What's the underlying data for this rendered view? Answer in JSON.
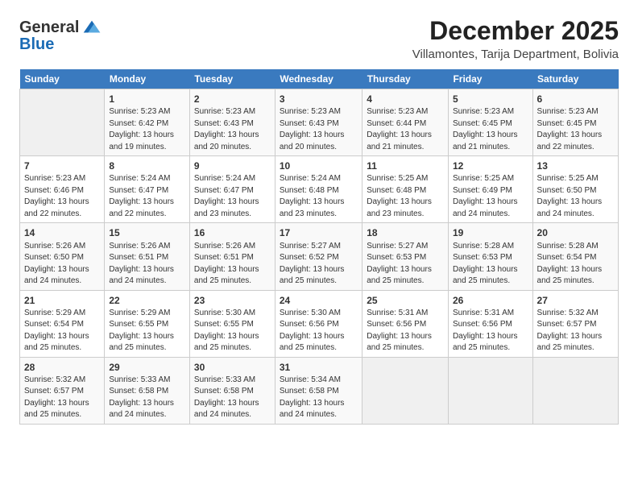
{
  "header": {
    "logo_line1": "General",
    "logo_line2": "Blue",
    "month": "December 2025",
    "location": "Villamontes, Tarija Department, Bolivia"
  },
  "days_of_week": [
    "Sunday",
    "Monday",
    "Tuesday",
    "Wednesday",
    "Thursday",
    "Friday",
    "Saturday"
  ],
  "weeks": [
    [
      {
        "day": "",
        "empty": true
      },
      {
        "day": "1",
        "sunrise": "Sunrise: 5:23 AM",
        "sunset": "Sunset: 6:42 PM",
        "daylight": "Daylight: 13 hours and 19 minutes."
      },
      {
        "day": "2",
        "sunrise": "Sunrise: 5:23 AM",
        "sunset": "Sunset: 6:43 PM",
        "daylight": "Daylight: 13 hours and 20 minutes."
      },
      {
        "day": "3",
        "sunrise": "Sunrise: 5:23 AM",
        "sunset": "Sunset: 6:43 PM",
        "daylight": "Daylight: 13 hours and 20 minutes."
      },
      {
        "day": "4",
        "sunrise": "Sunrise: 5:23 AM",
        "sunset": "Sunset: 6:44 PM",
        "daylight": "Daylight: 13 hours and 21 minutes."
      },
      {
        "day": "5",
        "sunrise": "Sunrise: 5:23 AM",
        "sunset": "Sunset: 6:45 PM",
        "daylight": "Daylight: 13 hours and 21 minutes."
      },
      {
        "day": "6",
        "sunrise": "Sunrise: 5:23 AM",
        "sunset": "Sunset: 6:45 PM",
        "daylight": "Daylight: 13 hours and 22 minutes."
      }
    ],
    [
      {
        "day": "7",
        "sunrise": "Sunrise: 5:23 AM",
        "sunset": "Sunset: 6:46 PM",
        "daylight": "Daylight: 13 hours and 22 minutes."
      },
      {
        "day": "8",
        "sunrise": "Sunrise: 5:24 AM",
        "sunset": "Sunset: 6:47 PM",
        "daylight": "Daylight: 13 hours and 22 minutes."
      },
      {
        "day": "9",
        "sunrise": "Sunrise: 5:24 AM",
        "sunset": "Sunset: 6:47 PM",
        "daylight": "Daylight: 13 hours and 23 minutes."
      },
      {
        "day": "10",
        "sunrise": "Sunrise: 5:24 AM",
        "sunset": "Sunset: 6:48 PM",
        "daylight": "Daylight: 13 hours and 23 minutes."
      },
      {
        "day": "11",
        "sunrise": "Sunrise: 5:25 AM",
        "sunset": "Sunset: 6:48 PM",
        "daylight": "Daylight: 13 hours and 23 minutes."
      },
      {
        "day": "12",
        "sunrise": "Sunrise: 5:25 AM",
        "sunset": "Sunset: 6:49 PM",
        "daylight": "Daylight: 13 hours and 24 minutes."
      },
      {
        "day": "13",
        "sunrise": "Sunrise: 5:25 AM",
        "sunset": "Sunset: 6:50 PM",
        "daylight": "Daylight: 13 hours and 24 minutes."
      }
    ],
    [
      {
        "day": "14",
        "sunrise": "Sunrise: 5:26 AM",
        "sunset": "Sunset: 6:50 PM",
        "daylight": "Daylight: 13 hours and 24 minutes."
      },
      {
        "day": "15",
        "sunrise": "Sunrise: 5:26 AM",
        "sunset": "Sunset: 6:51 PM",
        "daylight": "Daylight: 13 hours and 24 minutes."
      },
      {
        "day": "16",
        "sunrise": "Sunrise: 5:26 AM",
        "sunset": "Sunset: 6:51 PM",
        "daylight": "Daylight: 13 hours and 25 minutes."
      },
      {
        "day": "17",
        "sunrise": "Sunrise: 5:27 AM",
        "sunset": "Sunset: 6:52 PM",
        "daylight": "Daylight: 13 hours and 25 minutes."
      },
      {
        "day": "18",
        "sunrise": "Sunrise: 5:27 AM",
        "sunset": "Sunset: 6:53 PM",
        "daylight": "Daylight: 13 hours and 25 minutes."
      },
      {
        "day": "19",
        "sunrise": "Sunrise: 5:28 AM",
        "sunset": "Sunset: 6:53 PM",
        "daylight": "Daylight: 13 hours and 25 minutes."
      },
      {
        "day": "20",
        "sunrise": "Sunrise: 5:28 AM",
        "sunset": "Sunset: 6:54 PM",
        "daylight": "Daylight: 13 hours and 25 minutes."
      }
    ],
    [
      {
        "day": "21",
        "sunrise": "Sunrise: 5:29 AM",
        "sunset": "Sunset: 6:54 PM",
        "daylight": "Daylight: 13 hours and 25 minutes."
      },
      {
        "day": "22",
        "sunrise": "Sunrise: 5:29 AM",
        "sunset": "Sunset: 6:55 PM",
        "daylight": "Daylight: 13 hours and 25 minutes."
      },
      {
        "day": "23",
        "sunrise": "Sunrise: 5:30 AM",
        "sunset": "Sunset: 6:55 PM",
        "daylight": "Daylight: 13 hours and 25 minutes."
      },
      {
        "day": "24",
        "sunrise": "Sunrise: 5:30 AM",
        "sunset": "Sunset: 6:56 PM",
        "daylight": "Daylight: 13 hours and 25 minutes."
      },
      {
        "day": "25",
        "sunrise": "Sunrise: 5:31 AM",
        "sunset": "Sunset: 6:56 PM",
        "daylight": "Daylight: 13 hours and 25 minutes."
      },
      {
        "day": "26",
        "sunrise": "Sunrise: 5:31 AM",
        "sunset": "Sunset: 6:56 PM",
        "daylight": "Daylight: 13 hours and 25 minutes."
      },
      {
        "day": "27",
        "sunrise": "Sunrise: 5:32 AM",
        "sunset": "Sunset: 6:57 PM",
        "daylight": "Daylight: 13 hours and 25 minutes."
      }
    ],
    [
      {
        "day": "28",
        "sunrise": "Sunrise: 5:32 AM",
        "sunset": "Sunset: 6:57 PM",
        "daylight": "Daylight: 13 hours and 25 minutes."
      },
      {
        "day": "29",
        "sunrise": "Sunrise: 5:33 AM",
        "sunset": "Sunset: 6:58 PM",
        "daylight": "Daylight: 13 hours and 24 minutes."
      },
      {
        "day": "30",
        "sunrise": "Sunrise: 5:33 AM",
        "sunset": "Sunset: 6:58 PM",
        "daylight": "Daylight: 13 hours and 24 minutes."
      },
      {
        "day": "31",
        "sunrise": "Sunrise: 5:34 AM",
        "sunset": "Sunset: 6:58 PM",
        "daylight": "Daylight: 13 hours and 24 minutes."
      },
      {
        "day": "",
        "empty": true
      },
      {
        "day": "",
        "empty": true
      },
      {
        "day": "",
        "empty": true
      }
    ]
  ]
}
